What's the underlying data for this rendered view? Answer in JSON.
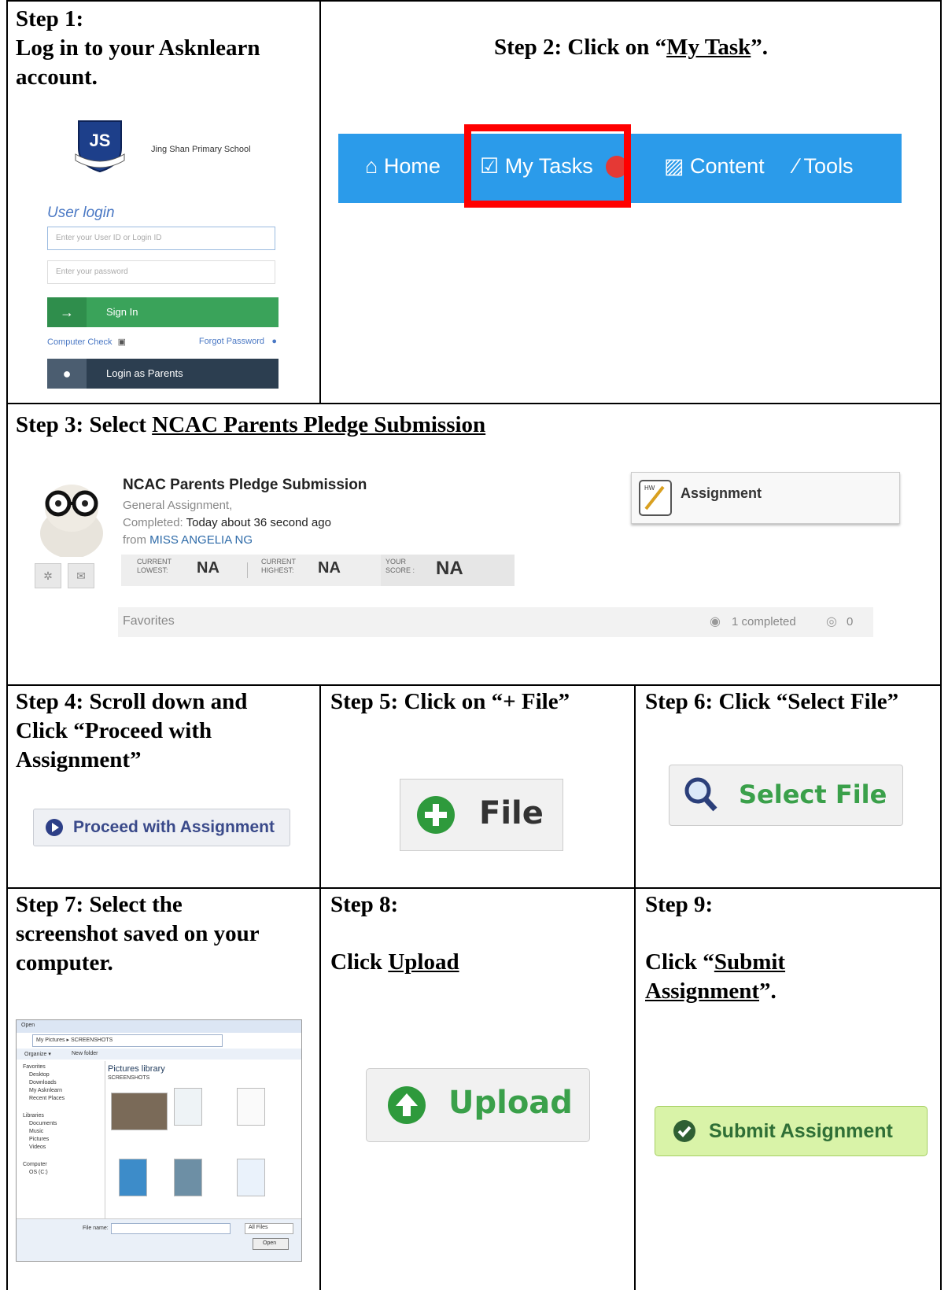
{
  "step1": {
    "label": "Step 1:",
    "text_line1": "Log in to your Asknlearn",
    "text_line2": "account.",
    "login": {
      "school_logo": "JS",
      "school_name": "Jing Shan Primary School",
      "title": "User login",
      "userid_placeholder": "Enter your User ID or Login ID",
      "password_placeholder": "Enter your password",
      "signin_label": "Sign In",
      "computer_check": "Computer Check",
      "forgot_password": "Forgot Password",
      "parents_label": "Login as Parents"
    }
  },
  "step2": {
    "prefix": "Step 2: Click on “",
    "link": "My Task",
    "suffix": "”.",
    "nav": {
      "home": "Home",
      "my_tasks": "My Tasks",
      "content": "Content",
      "tools": "Tools"
    }
  },
  "step3": {
    "prefix": "Step 3: Select ",
    "link": "NCAC Parents Pledge Submission",
    "card": {
      "title": "NCAC Parents Pledge Submission",
      "type": "General Assignment,",
      "completed_label": "Completed:",
      "completed_value": "Today about 36 second ago",
      "from_label": "from",
      "from_value": "MISS ANGELIA NG",
      "lowest_label_1": "CURRENT",
      "lowest_label_2": "LOWEST:",
      "lowest_value": "NA",
      "highest_label_1": "CURRENT",
      "highest_label_2": "HIGHEST:",
      "highest_value": "NA",
      "score_label_1": "YOUR",
      "score_label_2": "SCORE :",
      "score_value": "NA",
      "favorites": "Favorites",
      "completed_count": "1 completed",
      "comments_count": "0",
      "assignment_tag": "Assignment"
    }
  },
  "step4": {
    "line1": "Step 4: Scroll down and",
    "line2": "Click “Proceed with",
    "line3": "Assignment”",
    "button": "Proceed with Assignment"
  },
  "step5": {
    "title": "Step 5: Click on “+ File”",
    "button": "File"
  },
  "step6": {
    "title": "Step 6: Click “Select File”",
    "button": "Select File"
  },
  "step7": {
    "line1": "Step 7: Select the",
    "line2": "screenshot saved on your",
    "line3": "computer.",
    "dialog": {
      "title": "Open",
      "address": "My Pictures ▸ SCREENSHOTS",
      "organize": "Organize ▾",
      "new_folder": "New folder",
      "library_title": "Pictures library",
      "library_sub": "SCREENSHOTS",
      "sidebar": [
        "Favorites",
        "Desktop",
        "Downloads",
        "My Asknlearn",
        "Recent Places",
        "Libraries",
        "Documents",
        "Music",
        "Pictures",
        "Videos",
        "Computer",
        "OS (C:)"
      ],
      "filename_label": "File name:",
      "filter": "All Files",
      "open_btn": "Open"
    }
  },
  "step8": {
    "label": "Step 8:",
    "prefix": "Click ",
    "link": "Upload",
    "button": "Upload"
  },
  "step9": {
    "label": "Step 9:",
    "prefix": "Click “",
    "link1": "Submit",
    "link2": "Assignment",
    "suffix": "”.",
    "button": "Submit Assignment"
  },
  "colors": {
    "nav_blue": "#2b9bea",
    "highlight_red": "#ff0000",
    "green": "#3aa04a",
    "submit_bg": "#d9f3a8"
  }
}
